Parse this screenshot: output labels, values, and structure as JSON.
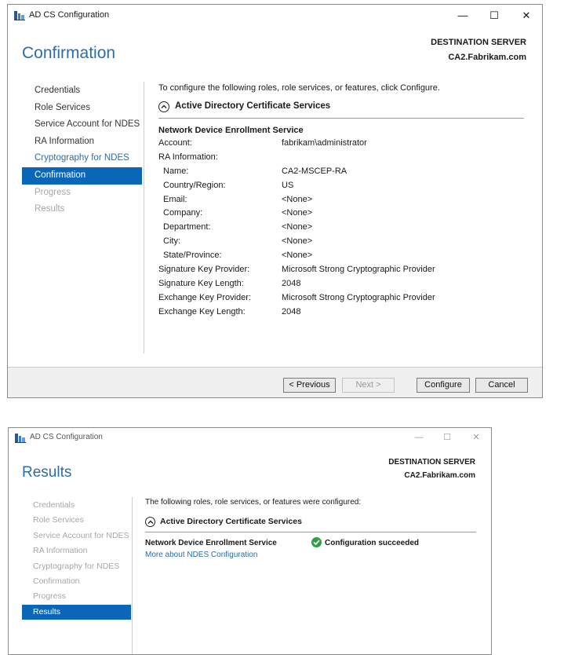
{
  "window1": {
    "title": "AD CS Configuration",
    "controls": {
      "minimize": "—",
      "maximize": "☐",
      "close": "✕"
    },
    "destination_label": "DESTINATION SERVER",
    "destination_server": "CA2.Fabrikam.com",
    "page_title": "Confirmation",
    "nav": [
      {
        "label": "Credentials",
        "state": "done"
      },
      {
        "label": "Role Services",
        "state": "done"
      },
      {
        "label": "Service Account for NDES",
        "state": "done"
      },
      {
        "label": "RA Information",
        "state": "done"
      },
      {
        "label": "Cryptography for NDES",
        "state": "link"
      },
      {
        "label": "Confirmation",
        "state": "active"
      },
      {
        "label": "Progress",
        "state": "disabled"
      },
      {
        "label": "Results",
        "state": "disabled"
      }
    ],
    "intro": "To configure the following roles, role services, or features, click Configure.",
    "section_title": "Active Directory Certificate Services",
    "service_title": "Network Device Enrollment Service",
    "details": [
      {
        "key": "Account:",
        "value": "fabrikam\\administrator",
        "indent": false
      },
      {
        "key": "RA Information:",
        "value": "",
        "indent": false
      },
      {
        "key": "Name:",
        "value": "CA2-MSCEP-RA",
        "indent": true
      },
      {
        "key": "Country/Region:",
        "value": "US",
        "indent": true
      },
      {
        "key": "Email:",
        "value": "<None>",
        "indent": true
      },
      {
        "key": "Company:",
        "value": "<None>",
        "indent": true
      },
      {
        "key": "Department:",
        "value": "<None>",
        "indent": true
      },
      {
        "key": "City:",
        "value": "<None>",
        "indent": true
      },
      {
        "key": "State/Province:",
        "value": "<None>",
        "indent": true
      },
      {
        "key": "Signature Key Provider:",
        "value": "Microsoft Strong Cryptographic Provider",
        "indent": false
      },
      {
        "key": "Signature Key Length:",
        "value": "2048",
        "indent": false
      },
      {
        "key": "Exchange Key Provider:",
        "value": "Microsoft Strong Cryptographic Provider",
        "indent": false
      },
      {
        "key": "Exchange Key Length:",
        "value": "2048",
        "indent": false
      }
    ],
    "buttons": {
      "previous": "< Previous",
      "next": "Next >",
      "configure": "Configure",
      "cancel": "Cancel"
    }
  },
  "window2": {
    "title": "AD CS Configuration",
    "controls": {
      "minimize": "—",
      "maximize": "☐",
      "close": "✕"
    },
    "destination_label": "DESTINATION SERVER",
    "destination_server": "CA2.Fabrikam.com",
    "page_title": "Results",
    "nav": [
      {
        "label": "Credentials",
        "state": "disabled"
      },
      {
        "label": "Role Services",
        "state": "disabled"
      },
      {
        "label": "Service Account for NDES",
        "state": "disabled"
      },
      {
        "label": "RA Information",
        "state": "disabled"
      },
      {
        "label": "Cryptography for NDES",
        "state": "disabled"
      },
      {
        "label": "Confirmation",
        "state": "disabled"
      },
      {
        "label": "Progress",
        "state": "disabled"
      },
      {
        "label": "Results",
        "state": "active"
      }
    ],
    "intro": "The following roles, role services, or features were configured:",
    "section_title": "Active Directory Certificate Services",
    "result": {
      "service": "Network Device Enrollment Service",
      "status": "Configuration succeeded",
      "link": "More about NDES Configuration"
    }
  },
  "colors": {
    "accent": "#2a6ea6",
    "selected_nav": "#0a67b8",
    "success": "#2ea043"
  }
}
